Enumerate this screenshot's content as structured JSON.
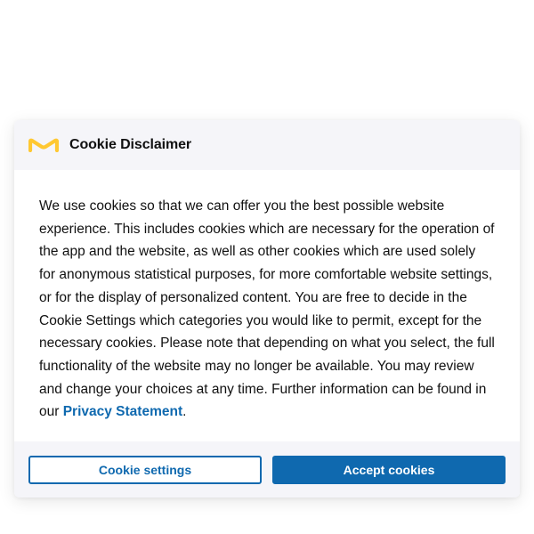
{
  "dialog": {
    "logo_icon": "merck-m-logo-icon",
    "logo_color": "#ffc832",
    "title": "Cookie Disclaimer",
    "body_text": "We use cookies so that we can offer you the best possible website experience. This includes cookies which are necessary for the operation of the app and the website, as well as other cookies which are used solely for anonymous statistical purposes, for more comfortable website settings, or for the display of personalized content. You are free to decide in the Cookie Settings which categories you would like to permit, except for the necessary cookies. Please note that depending on what you select, the full functionality of the website may no longer be available. You may review and change your choices at any time. Further information can be found in our ",
    "privacy_link": "Privacy Statement",
    "body_end": ".",
    "accent_color": "#0f69af"
  },
  "footer": {
    "settings_label": "Cookie settings",
    "accept_label": "Accept cookies"
  }
}
